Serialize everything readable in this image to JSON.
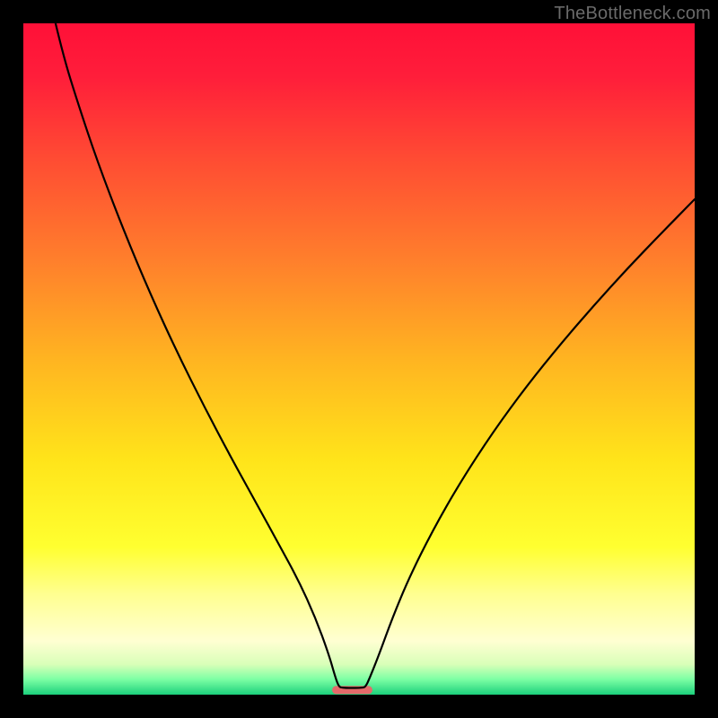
{
  "watermark": "TheBottleneck.com",
  "chart_data": {
    "type": "line",
    "title": "",
    "xlabel": "",
    "ylabel": "",
    "xlim": [
      0,
      100
    ],
    "ylim": [
      0,
      100
    ],
    "grid": false,
    "background_gradient": {
      "stops": [
        {
          "pos": 0.0,
          "color": "#ff1038"
        },
        {
          "pos": 0.08,
          "color": "#ff1e3a"
        },
        {
          "pos": 0.2,
          "color": "#ff4b33"
        },
        {
          "pos": 0.35,
          "color": "#ff7e2c"
        },
        {
          "pos": 0.5,
          "color": "#ffb421"
        },
        {
          "pos": 0.65,
          "color": "#ffe41a"
        },
        {
          "pos": 0.78,
          "color": "#ffff30"
        },
        {
          "pos": 0.85,
          "color": "#ffff90"
        },
        {
          "pos": 0.92,
          "color": "#ffffd2"
        },
        {
          "pos": 0.955,
          "color": "#d9ffb8"
        },
        {
          "pos": 0.977,
          "color": "#7dffa4"
        },
        {
          "pos": 1.0,
          "color": "#1cd07c"
        }
      ]
    },
    "series": [
      {
        "name": "bottleneck-curve",
        "color": "#000000",
        "width": 2.2,
        "data": [
          {
            "x": 4.8,
            "y": 100.0
          },
          {
            "x": 6.0,
            "y": 95.0
          },
          {
            "x": 8.0,
            "y": 88.5
          },
          {
            "x": 11.0,
            "y": 79.5
          },
          {
            "x": 15.0,
            "y": 69.0
          },
          {
            "x": 19.0,
            "y": 59.5
          },
          {
            "x": 23.0,
            "y": 50.8
          },
          {
            "x": 27.0,
            "y": 42.8
          },
          {
            "x": 31.0,
            "y": 35.2
          },
          {
            "x": 35.0,
            "y": 28.0
          },
          {
            "x": 38.0,
            "y": 22.5
          },
          {
            "x": 41.0,
            "y": 17.0
          },
          {
            "x": 43.5,
            "y": 11.5
          },
          {
            "x": 45.5,
            "y": 6.0
          },
          {
            "x": 46.5,
            "y": 2.5
          },
          {
            "x": 47.0,
            "y": 1.2
          },
          {
            "x": 47.5,
            "y": 1.0
          },
          {
            "x": 50.5,
            "y": 1.0
          },
          {
            "x": 51.0,
            "y": 1.2
          },
          {
            "x": 51.6,
            "y": 2.5
          },
          {
            "x": 53.0,
            "y": 6.0
          },
          {
            "x": 55.0,
            "y": 11.5
          },
          {
            "x": 57.5,
            "y": 17.5
          },
          {
            "x": 61.0,
            "y": 24.5
          },
          {
            "x": 65.0,
            "y": 31.5
          },
          {
            "x": 70.0,
            "y": 39.2
          },
          {
            "x": 75.0,
            "y": 46.0
          },
          {
            "x": 80.0,
            "y": 52.2
          },
          {
            "x": 85.0,
            "y": 58.0
          },
          {
            "x": 90.0,
            "y": 63.5
          },
          {
            "x": 95.0,
            "y": 68.7
          },
          {
            "x": 100.0,
            "y": 73.8
          }
        ]
      }
    ],
    "marker": {
      "name": "optimal-region",
      "x_start": 46.0,
      "x_end": 52.0,
      "y": 0.7,
      "height_pct": 1.2,
      "color": "#e46a6a",
      "rx_pct": 0.6
    }
  }
}
